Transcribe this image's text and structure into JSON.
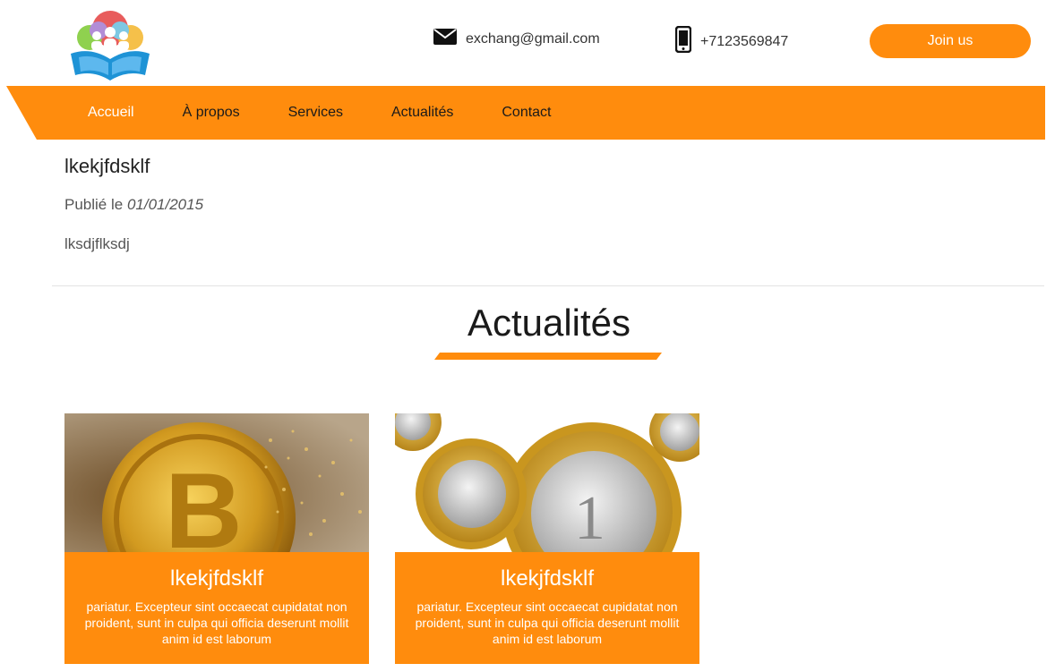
{
  "header": {
    "email": "exchang@gmail.com",
    "phone": "+7123569847",
    "join_label": "Join us"
  },
  "nav": {
    "items": [
      {
        "label": "Accueil"
      },
      {
        "label": "À propos"
      },
      {
        "label": "Services"
      },
      {
        "label": "Actualités"
      },
      {
        "label": "Contact"
      }
    ],
    "active_index": 0
  },
  "article": {
    "title": "lkekjfdsklf",
    "published_prefix": "Publié le",
    "published_date": "01/01/2015",
    "body": "lksdjflksdj"
  },
  "section": {
    "title": "Actualités"
  },
  "cards": [
    {
      "title": "lkekjfdsklf",
      "text": "pariatur. Excepteur sint occaecat cupidatat non proident, sunt in culpa qui officia deserunt mollit anim id est laborum",
      "image": "bitcoin-coin-image"
    },
    {
      "title": "lkekjfdsklf",
      "text": "pariatur. Excepteur sint occaecat cupidatat non proident, sunt in culpa qui officia deserunt mollit anim id est laborum",
      "image": "euro-coins-gears-image"
    }
  ],
  "colors": {
    "accent": "#ff8c0d",
    "nav_active_text": "#ffffff",
    "text_dark": "#1a1a1a"
  }
}
